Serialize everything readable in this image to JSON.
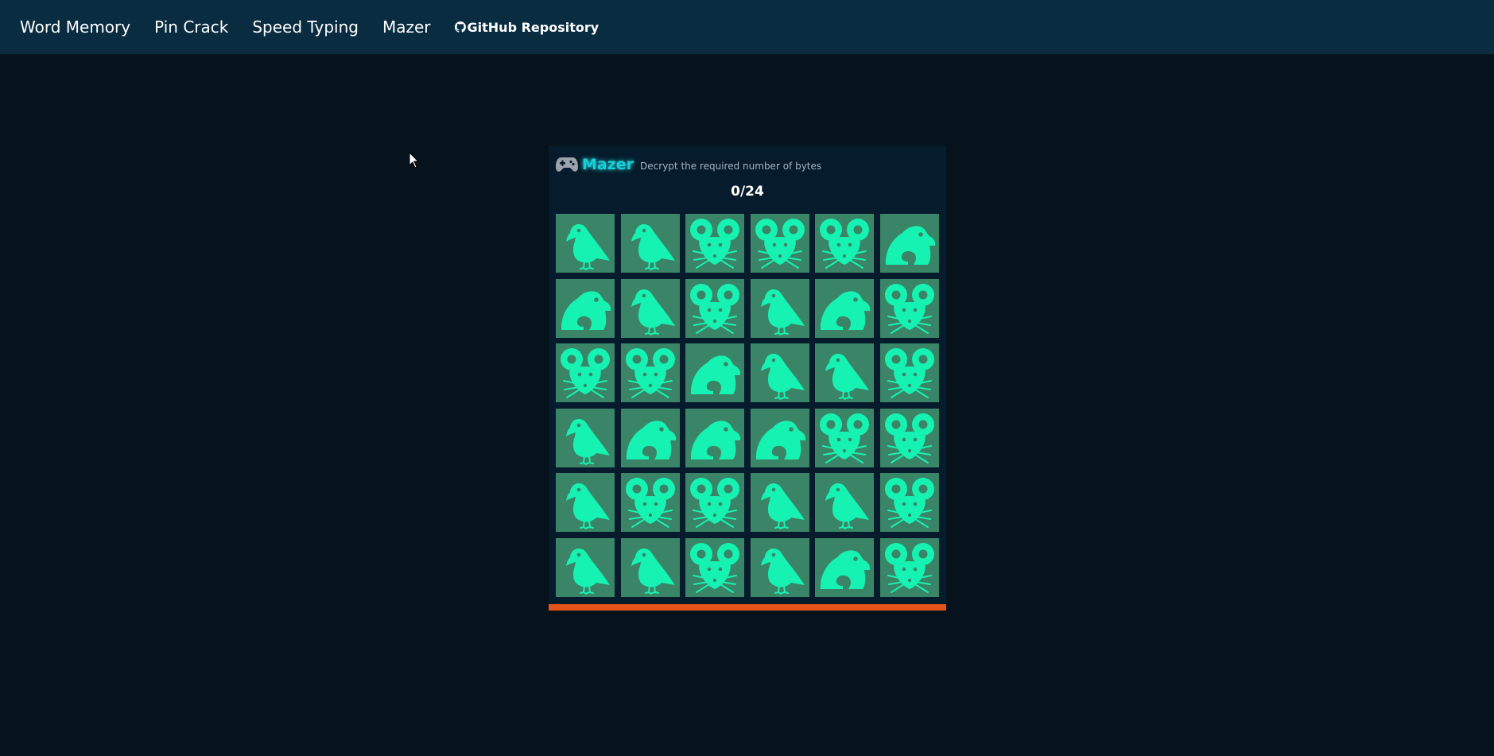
{
  "nav": {
    "links": [
      "Word Memory",
      "Pin Crack",
      "Speed Typing",
      "Mazer"
    ],
    "repo_label": "GitHub Repository"
  },
  "game": {
    "title": "Mazer",
    "subtitle": "Decrypt the required number of bytes",
    "counter": "0/24",
    "icon": "gamepad-icon",
    "timer_progress": 1.0,
    "colors": {
      "tile_bg": "#3a8567",
      "glyph": "#16f2b1",
      "timer": "#e4531a",
      "title": "#19cfd6"
    },
    "grid": [
      [
        "bird",
        "bird",
        "mouse",
        "mouse",
        "mouse",
        "frog"
      ],
      [
        "frog",
        "bird",
        "mouse",
        "bird",
        "frog",
        "mouse"
      ],
      [
        "mouse",
        "mouse",
        "frog",
        "bird",
        "bird",
        "mouse"
      ],
      [
        "bird",
        "frog",
        "frog",
        "frog",
        "mouse",
        "mouse"
      ],
      [
        "bird",
        "mouse",
        "mouse",
        "bird",
        "bird",
        "mouse"
      ],
      [
        "bird",
        "bird",
        "mouse",
        "bird",
        "frog",
        "mouse"
      ]
    ]
  }
}
